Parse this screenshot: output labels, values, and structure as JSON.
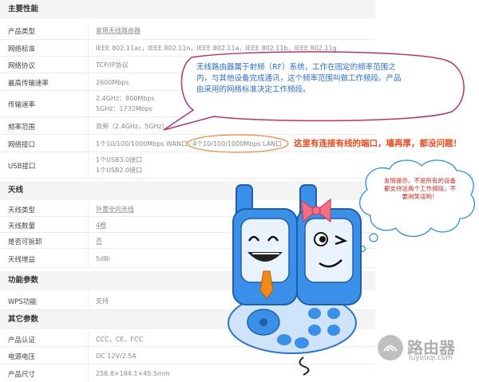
{
  "sections": {
    "main": "主要性能",
    "antenna": "天线",
    "function": "功能参数",
    "other": "其它参数"
  },
  "specs": {
    "product_type": {
      "label": "产品类型",
      "value": "家用无线路由器"
    },
    "network_std": {
      "label": "网络标准",
      "value": "IEEE 802.11ac，IEEE 802.11n，IEEE 802.11a，IEEE 802.11b，IEEE 802.11g"
    },
    "protocol": {
      "label": "网络协议",
      "value": "TCP/IP协议"
    },
    "max_rate": {
      "label": "最高传输速率",
      "value": "2600Mbps"
    },
    "rate": {
      "label": "传输速率",
      "value1": "2.4GHz：800Mbps",
      "value2": "5GHz：1732Mbps"
    },
    "freq": {
      "label": "频率范围",
      "value": "双频（2.4GHz，5GHz）"
    },
    "ports": {
      "label": "网络接口",
      "wan": "1个10/100/1000Mbps WAN口",
      "lan": "4个10/100/1000Mbps LAN口"
    },
    "usb": {
      "label": "USB接口",
      "value1": "1个USB3.0接口",
      "value2": "1个USB2.0接口"
    },
    "ant_type": {
      "label": "天线类型",
      "value": "外置全向天线"
    },
    "ant_count": {
      "label": "天线数量",
      "value": "4根"
    },
    "detach": {
      "label": "是否可拆卸",
      "value": "否"
    },
    "gain": {
      "label": "天线增益",
      "value": "5dBi"
    },
    "wps": {
      "label": "WPS功能",
      "value": "支持"
    },
    "cert": {
      "label": "产品认证",
      "value": "CCC，CE，FCC"
    },
    "power": {
      "label": "电源电压",
      "value": "DC 12V/2.5A"
    },
    "size": {
      "label": "产品尺寸",
      "value": "258.8×184.1×45.5mm"
    }
  },
  "annotations": {
    "bubble": [
      "无线路由器属于射频（RF）系统，工作在固定的频率范围之",
      "内，与其他设备完成通讯，这个频率范围叫做工作频段。产品",
      "由采用的网络标准决定工作频段。"
    ],
    "port_note": "这里有连接有线的端口，墙再厚，都没问题！",
    "tip": [
      "友情提示，不是所有的设备",
      "都支持这两个工作频段。不",
      "要闹笑话哟！"
    ]
  },
  "watermark": {
    "name": "路由器",
    "url": "luyouqi.com"
  },
  "colors": {
    "bubble_border": "#b0356e",
    "bubble_text": "#2a6cc4",
    "note": "#e8481c",
    "robot_blue": "#3a8fe8",
    "bow": "#f26f86"
  }
}
